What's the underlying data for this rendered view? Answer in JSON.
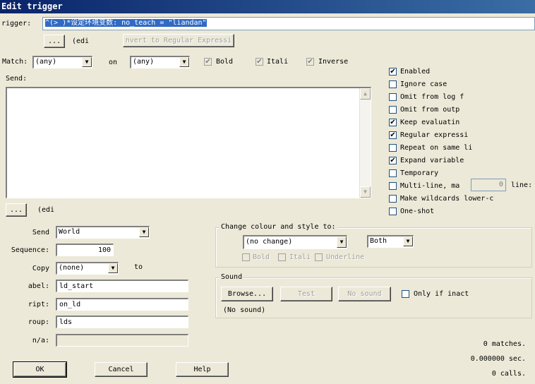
{
  "window": {
    "title": "Edit trigger"
  },
  "trigger": {
    "label": "rigger:",
    "value": "^(> )*设定环境变数: no_teach = \"liandan\"",
    "edit_button": "...",
    "edit_hint": "(edi",
    "convert_button": "nvert to Regular Expressi"
  },
  "match": {
    "label": "Match:",
    "fg_value": "(any)",
    "on_label": "on",
    "bg_value": "(any)",
    "bold_label": "Bold",
    "italic_label": "Itali",
    "inverse_label": "Inverse",
    "bold_checked": true,
    "italic_checked": true,
    "inverse_checked": true
  },
  "send": {
    "label": "Send:",
    "edit_button": "...",
    "edit_hint": "(edi"
  },
  "options": [
    {
      "label": "Enabled",
      "checked": true
    },
    {
      "label": "Ignore case",
      "checked": false
    },
    {
      "label": "Omit from log f",
      "checked": false
    },
    {
      "label": "Omit from outp",
      "checked": false
    },
    {
      "label": "Keep evaluatin",
      "checked": true
    },
    {
      "label": "Regular expressi",
      "checked": true
    },
    {
      "label": "Repeat on same li",
      "checked": false
    },
    {
      "label": "Expand variable",
      "checked": true
    },
    {
      "label": "Temporary",
      "checked": false
    },
    {
      "label": "Multi-line, ma",
      "checked": false
    },
    {
      "label": "Make wildcards lower-c",
      "checked": false
    },
    {
      "label": "One-shot",
      "checked": false
    }
  ],
  "multiline": {
    "value": "0",
    "suffix": "line:"
  },
  "form": {
    "send_to_label": "Send",
    "send_to_value": "World",
    "sequence_label": "Sequence:",
    "sequence_value": "100",
    "copy_label": "Copy",
    "copy_value": "(none)",
    "copy_to_label": "to",
    "label_label": "abel:",
    "label_value": "ld_start",
    "script_label": "ript:",
    "script_value": "on_ld",
    "group_label": "roup:",
    "group_value": "lds",
    "var_label": "n/a:",
    "var_value": ""
  },
  "colour": {
    "title": "Change colour and style to:",
    "colour_value": "(no change)",
    "both_value": "Both",
    "bold_label": "Bold",
    "italic_label": "Itali",
    "underline_label": "Underline"
  },
  "sound": {
    "title": "Sound",
    "browse_button": "Browse...",
    "test_button": "Test",
    "no_sound_button": "No sound",
    "only_inactive_label": "Only if inact",
    "current": "(No sound)"
  },
  "stats": {
    "matches": "0 matches.",
    "seconds": "0.000000 sec.",
    "calls": "0 calls."
  },
  "buttons": {
    "ok": "OK",
    "cancel": "Cancel",
    "help": "Help"
  }
}
